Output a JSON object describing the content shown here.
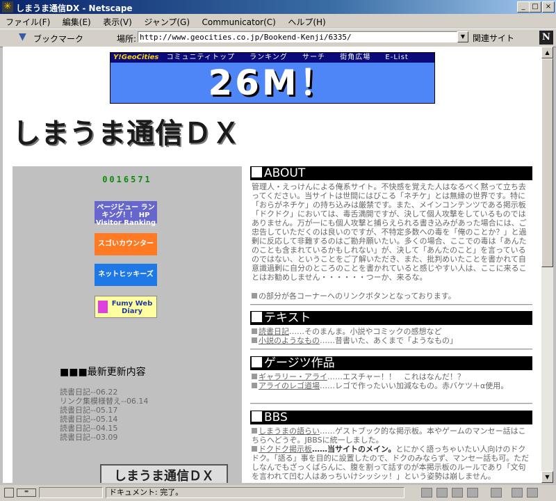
{
  "window": {
    "title": "しまうま通信DX - Netscape",
    "minimize": "_",
    "maximize": "□",
    "close": "×"
  },
  "menu": [
    "ファイル(F)",
    "編集(E)",
    "表示(V)",
    "ジャンプ(G)",
    "Communicator(C)",
    "ヘルプ(H)"
  ],
  "toolbar": {
    "bookmarks_label": "ブックマーク",
    "location_label": "場所:",
    "url": "http://www.geocities.co.jp/Bookend-Kenji/6335/",
    "related_label": "関連サイト"
  },
  "banner": {
    "brand": "Y!GeoCities",
    "nav": [
      "コミュニティトップ",
      "ランキング",
      "サーチ",
      "街角広場",
      "E-List"
    ],
    "headline": "26M！"
  },
  "site_title": "しまうま通信ＤＸ",
  "left": {
    "counter": "0016571",
    "buttons": {
      "pageview": "ページビュー ランキング！！ HP Visitor Ranking",
      "sugoi": "スゴいカウンター",
      "net": "ネットヒッキーズ",
      "diary": "Fumy Web Diary"
    },
    "updates_title": "■■■最新更新内容",
    "updates": [
      "読書日記--06.22",
      "リンク集模様替え--06.14",
      "読書日記--05.17",
      "読書日記--05.14",
      "読書日記--04.15",
      "読書日記--03.09"
    ],
    "footer_logo": "しまうま通信ＤＸ"
  },
  "sections": {
    "about": {
      "heading": "ABOUT",
      "text": "管理人・えっけんによる俺系サイト。不快感を覚えた人はなるべく黙って立ち去ってください。当サイトは世間にはびこる「ネチケ」とは無縁の世界です。特に「おらがネチケ」の持ち込みは厳禁です。また、メインコンテンツである掲示板「ドクドク」においては、毒舌満開ですが、決して個人攻撃をしているものではありません。万が一にも個人攻撃と捕らえられる書き込みがあった場合には、ご忠告していただくのは良いのですが、不特定多数への毒を「俺のことか？」と過剰に反応して非難するのはご勘弁願いたい。多くの場合、ここでの毒は「あんたのことも含まれているかもしれない」が、決して「あんたのこと」を言っているのではない、ということをご了解いただき、また、批判めいたことを書かれて自意識過剰に自分のところのことを書かれていると感じやすい人は、ここに来ることはお勧めしません・・・・・・つーか、来るな。",
      "note": "の部分が各コーナーへのリンクボタンとなっております。"
    },
    "text": {
      "heading": "テキスト",
      "items": [
        {
          "link": "読書日記",
          "desc": "……そのまんま。小説やコミックの感想など"
        },
        {
          "link": "小説のようなもの",
          "desc": "……昔書いた、あくまで「ようなもの」"
        }
      ]
    },
    "geijutsu": {
      "heading": "ゲージツ作品",
      "items": [
        {
          "link": "ギャラリー・アライ",
          "desc": "……エスチャー！！　これはなんだ！？"
        },
        {
          "link": "アライのレゴ道場",
          "desc": "……レゴで作ったいい加減なもの。赤バケツ＋α使用。"
        }
      ]
    },
    "bbs": {
      "heading": "BBS",
      "item1_link": "しまうまの語らい",
      "item1_desc": "……ゲストブック的な掲示板。本やゲームのマンセー話はこちらへどうぞ。JBBSに統一しました。",
      "item2_link": "ドクドク掲示板",
      "item2_bold": "……当サイトのメイン。",
      "item2_desc": "とにかく語っちゃいたい人向けのドクドク。「語る」事を目的に設置したので、ドクのみならず、マンセー話も可。ただしなんでもざっくばらんに、腹を割って話すのが本掲示板のルールであり「文句を言われて凹む人はあっちいけシッシッ！」という姿勢は崩しません。"
    }
  },
  "status": {
    "text": "ドキュメント: 完了。"
  }
}
